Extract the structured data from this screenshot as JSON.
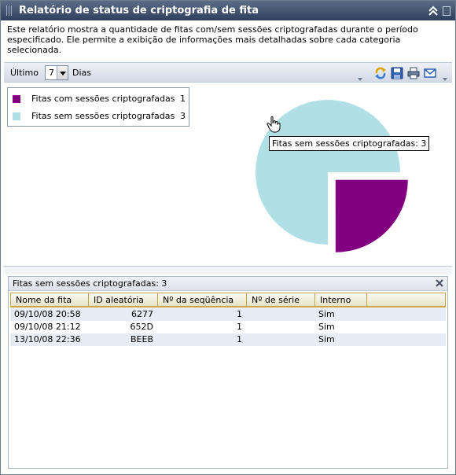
{
  "window": {
    "title": "Relatório de status de criptografia de fita",
    "description": "Este relatório mostra a quantidade de fitas com/sem sessões criptografadas durante o período especificado. Ele permite a exibição de informações mais detalhadas sobre cada categoria selecionada."
  },
  "toolbar": {
    "last_label": "Último",
    "days_value": "7",
    "days_label": "Dias",
    "buttons": [
      "refresh-icon",
      "save-icon",
      "print-icon",
      "email-icon"
    ]
  },
  "colors": {
    "with_sessions": "#800080",
    "without_sessions": "#b0dfe5",
    "title_bar": "#3d4f6c",
    "header_border": "#c8a447"
  },
  "legend": [
    {
      "label": "Fitas com sessões criptografadas",
      "count": "1"
    },
    {
      "label": "Fitas sem sessões criptografadas",
      "count": "3"
    }
  ],
  "chart_data": {
    "type": "pie",
    "categories": [
      "Fitas com sessões criptografadas",
      "Fitas sem sessões criptografadas"
    ],
    "values": [
      1,
      3
    ],
    "exploded": "Fitas com sessões criptografadas",
    "tooltip": "Fitas sem sessões criptografadas: 3"
  },
  "grid": {
    "title": "Fitas sem sessões criptografadas: 3",
    "columns": [
      "Nome da fita",
      "ID aleatória",
      "Nº da seqüência",
      "Nº de série",
      "Interno"
    ],
    "rows": [
      [
        "09/10/08 20:58",
        "6277",
        "1",
        "",
        "Sim"
      ],
      [
        "09/10/08 21:12",
        "652D",
        "1",
        "",
        "Sim"
      ],
      [
        "13/10/08 22:36",
        "BEEB",
        "1",
        "",
        "Sim"
      ]
    ]
  }
}
